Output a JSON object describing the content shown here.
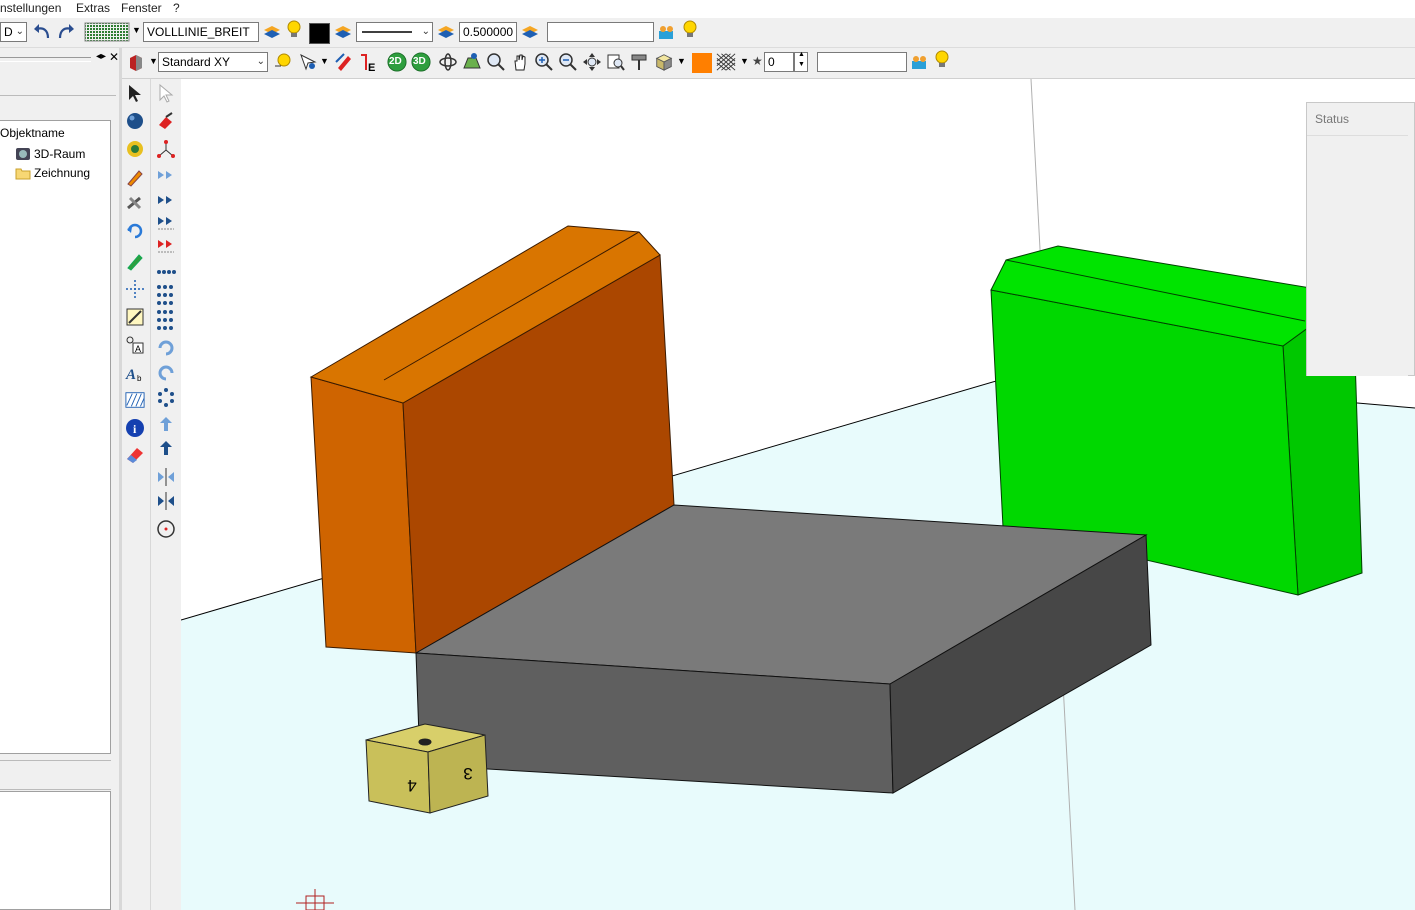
{
  "menu": {
    "items": [
      {
        "label": "nstellungen"
      },
      {
        "label": "Extras"
      },
      {
        "label": "Fenster"
      },
      {
        "label": "?"
      }
    ]
  },
  "toolbar1": {
    "view_combo": "D",
    "linetype_name": "VOLLLINIE_BREIT",
    "line_width": "0.500000",
    "text_field": ""
  },
  "toolbar2": {
    "view_select": "Standard XY",
    "btn_2d": "2D",
    "btn_3d": "3D",
    "counter_value": "0",
    "text_field": ""
  },
  "left_panel": {
    "column_header": "Objektname",
    "tree": [
      {
        "label": "3D-Raum",
        "icon": "cube-icon"
      },
      {
        "label": "Zeichnung",
        "icon": "folder-icon"
      }
    ]
  },
  "status_panel": {
    "title": "Status"
  },
  "scene": {
    "dice_faces": [
      "4",
      "3"
    ],
    "colors": {
      "orange_front": "#ab4700",
      "orange_side": "#cf6400",
      "orange_top": "#d97500",
      "gray_top": "#7a7a7a",
      "gray_front": "#5f5f5f",
      "gray_side": "#474747",
      "green": "#00d000",
      "green_top": "#00e000",
      "floor": "#e8fbfc",
      "dice": "#c9c05a"
    }
  }
}
